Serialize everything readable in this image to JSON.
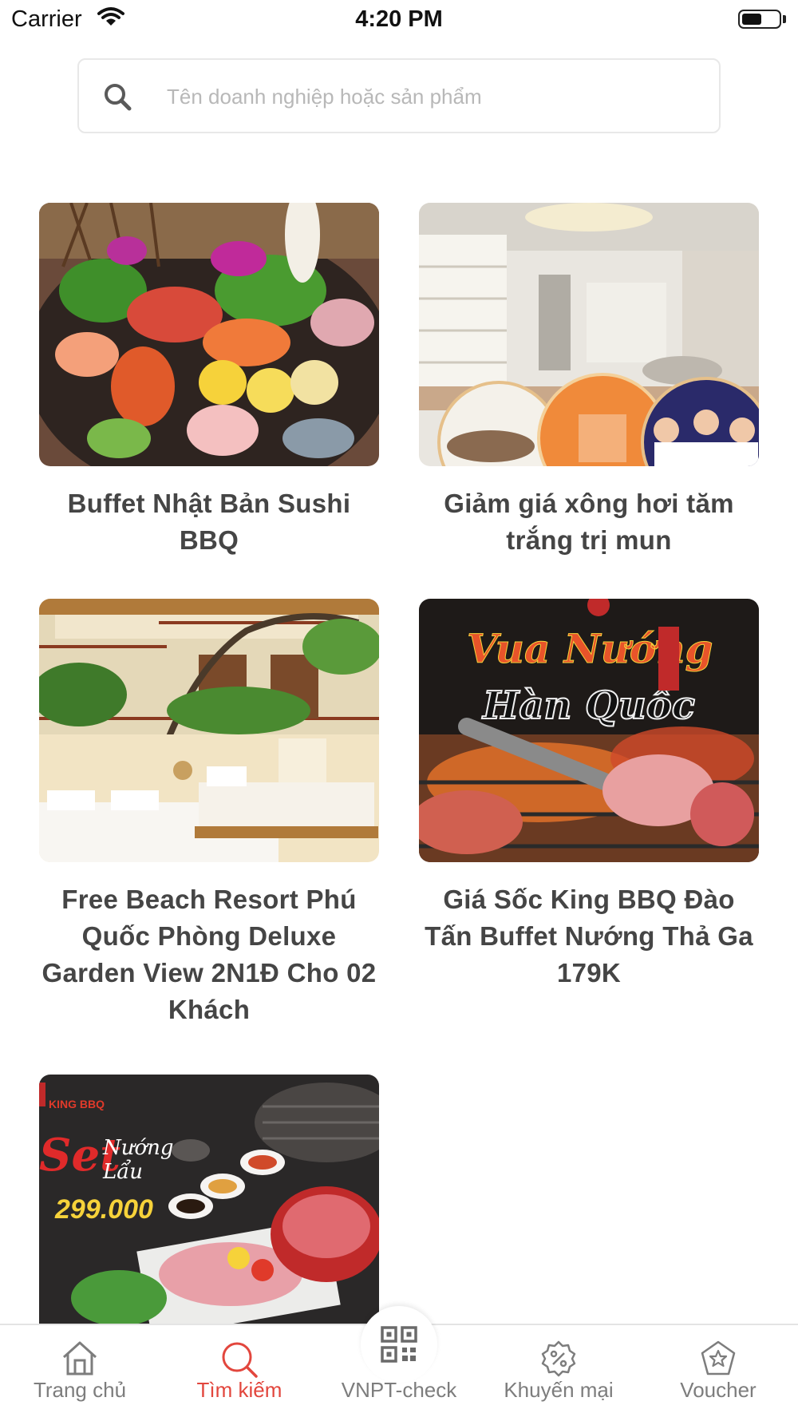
{
  "status_bar": {
    "carrier": "Carrier",
    "time": "4:20 PM",
    "battery_level": 0.55
  },
  "search": {
    "placeholder": "Tên doanh nghiệp hoặc sản phẩm",
    "value": ""
  },
  "cards": [
    {
      "title": "Buffet Nhật Bản Sushi BBQ",
      "image": "sushi-platter"
    },
    {
      "title": "Giảm giá xông hơi tăm trắng trị mun",
      "image": "spa-interior"
    },
    {
      "title": "Free Beach Resort Phú Quốc  Phòng Deluxe Garden View 2N1Đ  Cho 02 Khách",
      "image": "resort-room"
    },
    {
      "title": "Giá Sốc King BBQ Đào Tấn Buffet Nướng Thả Ga 179K",
      "image": "korean-bbq"
    },
    {
      "title": "",
      "image": "bbq-set",
      "image_text": {
        "brand": "KING BBQ",
        "set": "Set",
        "line1": "Nướng",
        "line2": "Lẩu",
        "price": "299.000"
      }
    }
  ],
  "banner_text": {
    "vua_nuong": "Vua Nướng",
    "han_quoc": "Hàn Quốc"
  },
  "tabs": [
    {
      "label": "Trang chủ",
      "icon": "home-icon",
      "active": false
    },
    {
      "label": "Tìm kiếm",
      "icon": "search-icon",
      "active": true
    },
    {
      "label": "VNPT-check",
      "icon": "qr-code-icon",
      "active": false
    },
    {
      "label": "Khuyến mại",
      "icon": "discount-badge-icon",
      "active": false
    },
    {
      "label": "Voucher",
      "icon": "star-badge-icon",
      "active": false
    }
  ],
  "colors": {
    "accent": "#e2463d",
    "tab_inactive": "#7d7d7d",
    "title_text": "#454545"
  }
}
